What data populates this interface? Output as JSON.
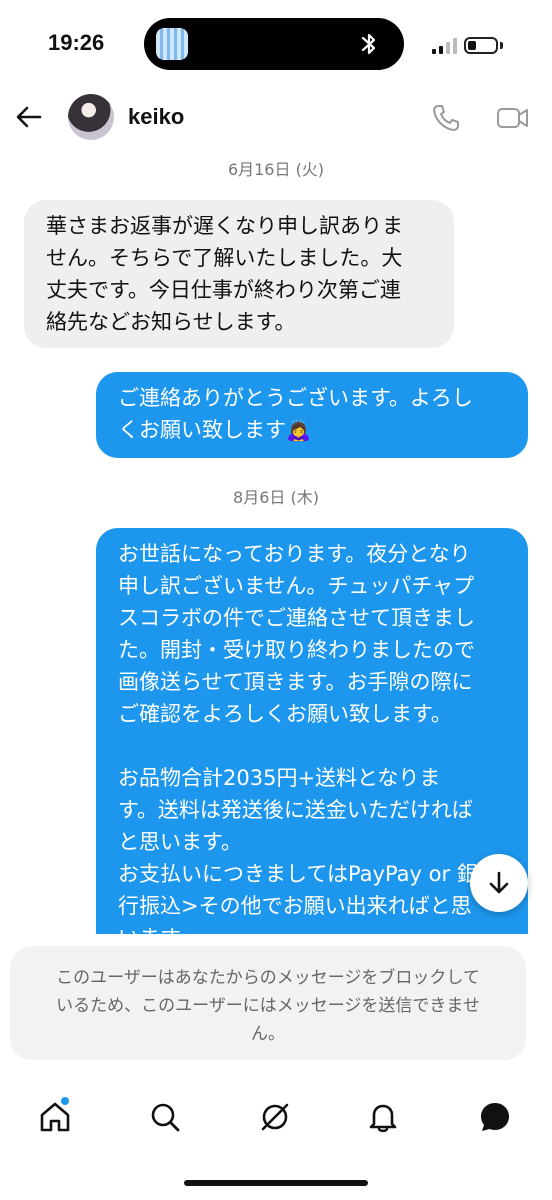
{
  "status_bar": {
    "time": "19:26"
  },
  "header": {
    "username": "keiko"
  },
  "messages": [
    {
      "type": "date",
      "text": "6月16日 (火)"
    },
    {
      "type": "incoming",
      "lines": [
        "華さまお返事が遅くなり申し訳ありま",
        "せん。そちらで了解いたしました。大",
        "丈夫です。今日仕事が終わり次第ご連",
        "絡先などお知らせします。"
      ]
    },
    {
      "type": "outgoing",
      "lines": [
        "ご連絡ありがとうございます。よろし",
        "くお願い致します"
      ],
      "emoji": "🙇‍♀️"
    },
    {
      "type": "date",
      "text": "8月6日 (木)"
    },
    {
      "type": "outgoing",
      "lines": [
        "お世話になっております。夜分となり",
        "申し訳ございません。チュッパチャプ",
        "スコラボの件でご連絡させて頂きまし",
        "た。開封・受け取り終わりましたので",
        "画像送らせて頂きます。お手隙の際に",
        "ご確認をよろしくお願い致します。",
        "",
        "お品物合計2035円+送料となりま",
        "す。送料は発送後に送金いただければ",
        "と思います。",
        "お支払いにつきましてはPayPay or 銀",
        "行振込>その他でお願い出来ればと思",
        "います。"
      ]
    }
  ],
  "blocked_notice": {
    "lines": [
      "このユーザーはあなたからのメッセージをブロックして",
      "いるため、このユーザーにはメッセージを送信できませ",
      "ん。"
    ]
  },
  "icons": {
    "back": "arrow-left-icon",
    "call": "phone-icon",
    "video": "video-camera-icon",
    "scroll": "arrow-down-icon",
    "nav": [
      "home-icon",
      "search-icon",
      "explore-icon",
      "notifications-icon",
      "messages-icon"
    ]
  },
  "colors": {
    "accent": "#1d97ee",
    "incoming_bubble": "#efeff1",
    "notice_bg": "#f2f2f4"
  }
}
